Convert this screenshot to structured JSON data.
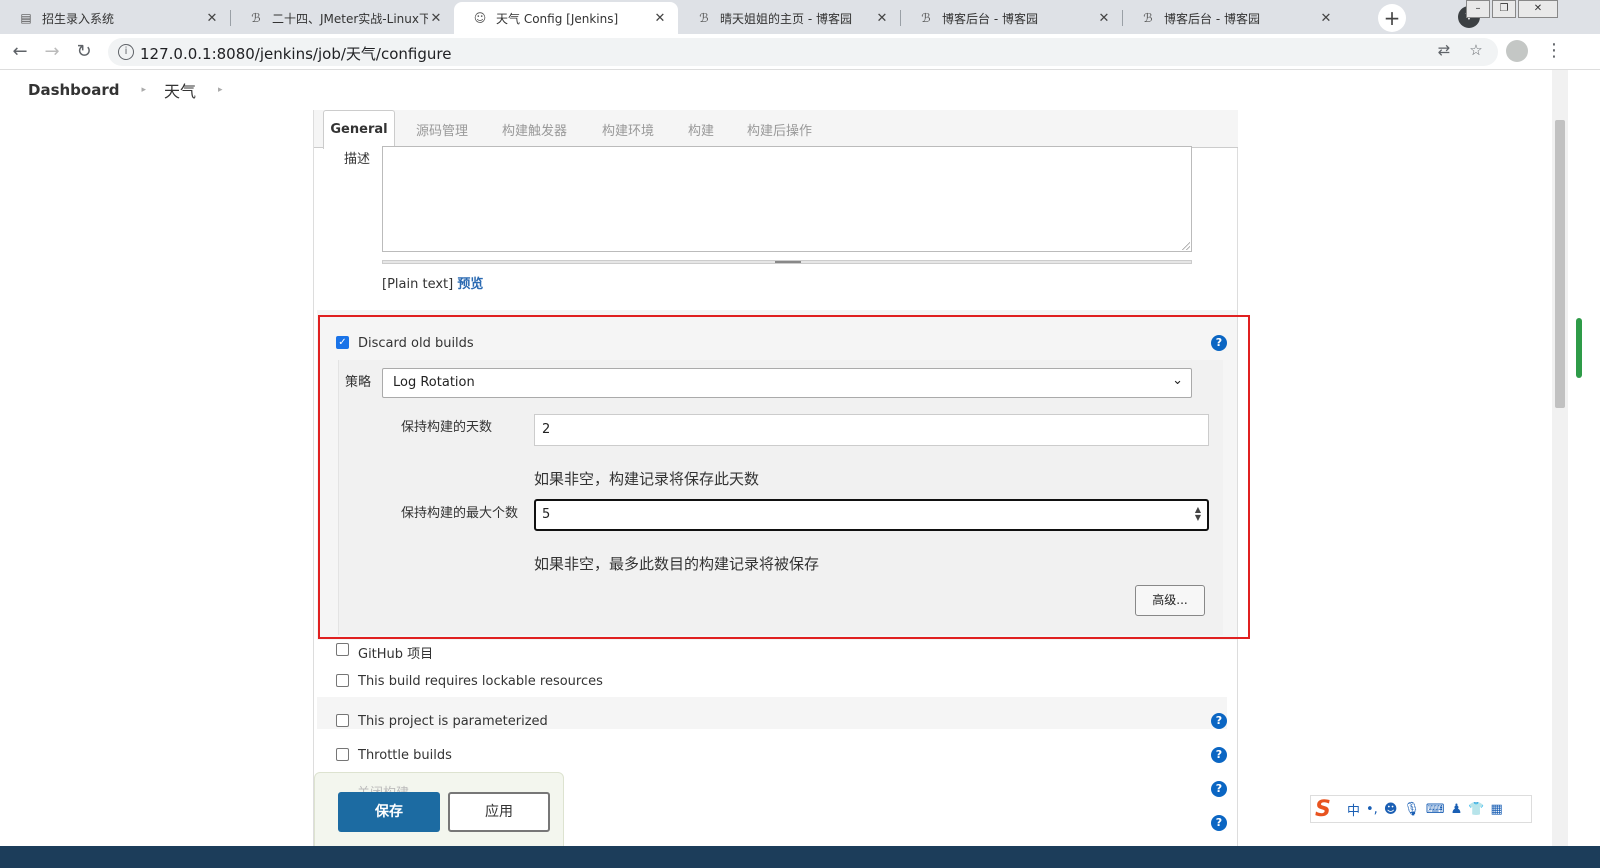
{
  "browser": {
    "tabs": [
      {
        "title": "招生录入系统",
        "icon": "document-icon"
      },
      {
        "title": "二十四、JMeter实战-Linux下",
        "icon": "cnblogs-icon"
      },
      {
        "title": "天气 Config [Jenkins]",
        "icon": "jenkins-icon"
      },
      {
        "title": "晴天姐姐的主页 - 博客园",
        "icon": "cnblogs-icon"
      },
      {
        "title": "博客后台 - 博客园",
        "icon": "cnblogs-icon"
      },
      {
        "title": "博客后台 - 博客园",
        "icon": "cnblogs-icon"
      }
    ],
    "url": "127.0.0.1:8080/jenkins/job/天气/configure"
  },
  "breadcrumbs": [
    "Dashboard",
    "天气"
  ],
  "config_tabs": [
    "General",
    "源码管理",
    "构建触发器",
    "构建环境",
    "构建",
    "构建后操作"
  ],
  "description": {
    "label": "描述",
    "value": "",
    "plain_text": "[Plain text]",
    "preview_link": "预览"
  },
  "discard": {
    "label": "Discard old builds",
    "checked": true,
    "strategy_label": "策略",
    "strategy_value": "Log Rotation",
    "days_label": "保持构建的天数",
    "days_value": "2",
    "days_hint": "如果非空，构建记录将保存此天数",
    "max_label": "保持构建的最大个数",
    "max_value": "5",
    "max_hint": "如果非空，最多此数目的构建记录将被保存",
    "advanced_button": "高级..."
  },
  "options": [
    {
      "label": "GitHub 项目",
      "checked": false
    },
    {
      "label": "This build requires lockable resources",
      "checked": false
    },
    {
      "label": "This project is parameterized",
      "checked": false
    },
    {
      "label": "Throttle builds",
      "checked": false
    },
    {
      "label": "关闭构建",
      "checked": false
    }
  ],
  "buttons": {
    "save": "保存",
    "apply": "应用"
  },
  "ime": {
    "mode": "中"
  },
  "colors": {
    "accent": "#1c6ba2",
    "highlight": "#e02020",
    "help": "#0b66c3"
  }
}
